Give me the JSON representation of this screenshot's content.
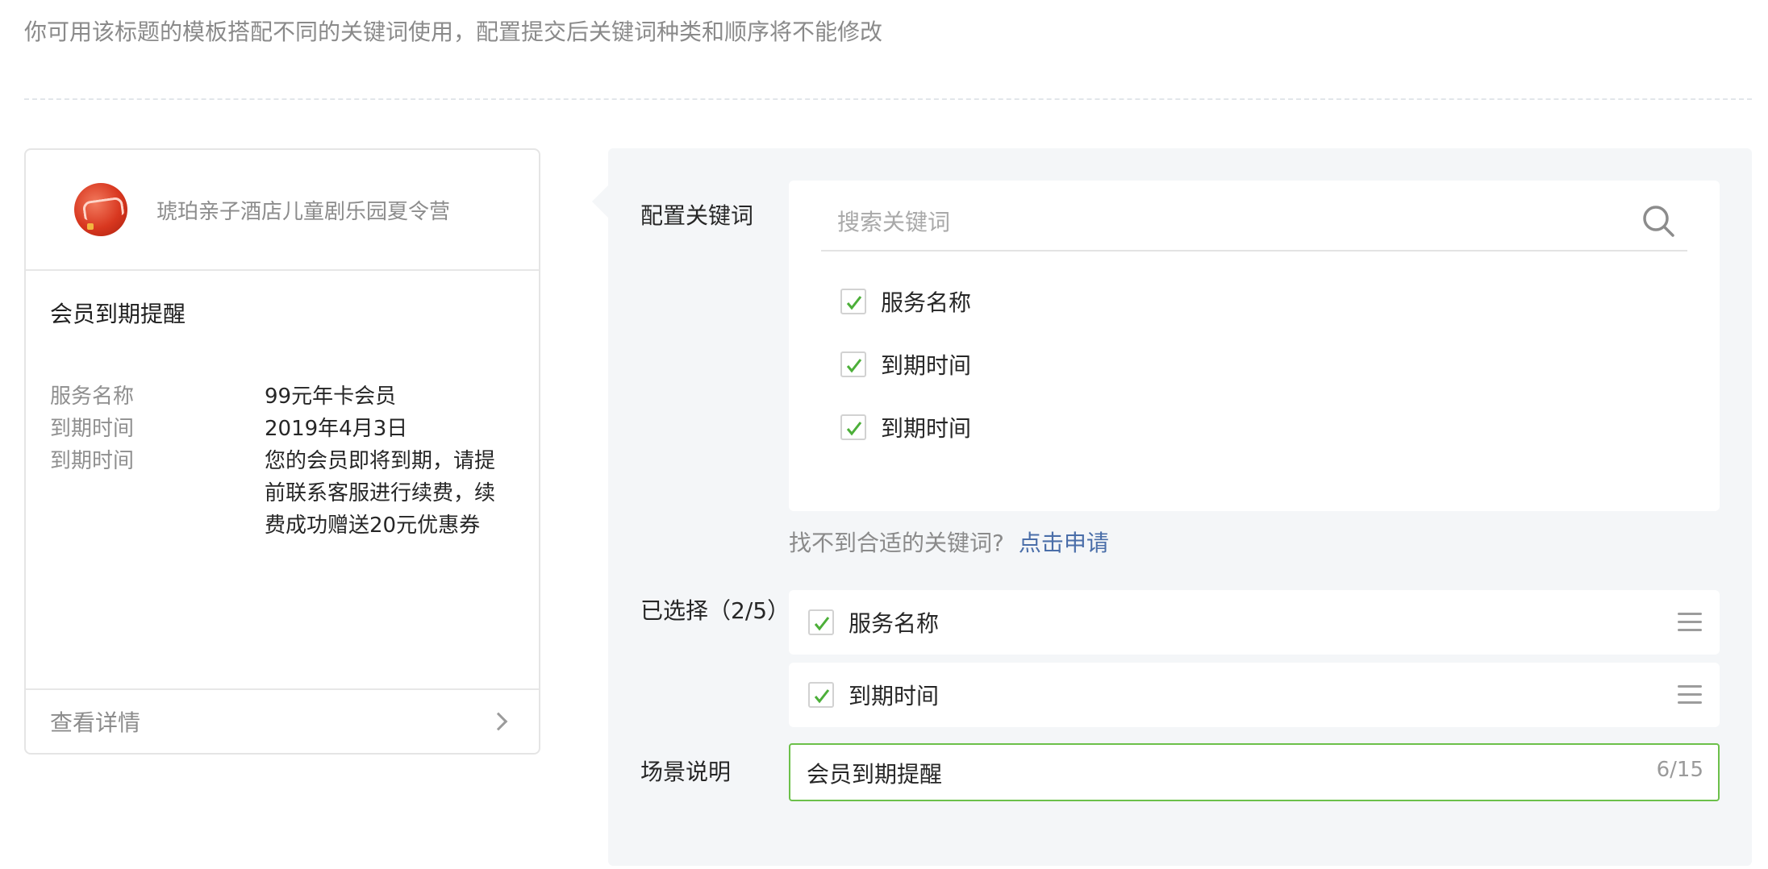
{
  "hint": "你可用该标题的模板搭配不同的关键词使用，配置提交后关键词种类和顺序将不能修改",
  "preview": {
    "account_name": "琥珀亲子酒店儿童剧乐园夏令营",
    "template_title": "会员到期提醒",
    "fields": [
      {
        "key": "服务名称",
        "value": "99元年卡会员"
      },
      {
        "key": "到期时间",
        "value": "2019年4月3日"
      },
      {
        "key": "到期时间",
        "value": "您的会员即将到期，请提前联系客服进行续费，续费成功赠送20元优惠券"
      }
    ],
    "detail_label": "查看详情"
  },
  "config": {
    "keywords_label": "配置关键词",
    "search_placeholder": "搜索关键词",
    "keyword_options": [
      {
        "label": "服务名称",
        "checked": true
      },
      {
        "label": "到期时间",
        "checked": true
      },
      {
        "label": "到期时间",
        "checked": true
      }
    ],
    "not_found_text": "找不到合适的关键词?",
    "apply_link": "点击申请",
    "selected_label": "已选择（2/5）",
    "selected_items": [
      {
        "label": "服务名称",
        "checked": true
      },
      {
        "label": "到期时间",
        "checked": true
      }
    ],
    "scene_label": "场景说明",
    "scene_value": "会员到期提醒",
    "scene_counter": "6/15"
  },
  "colors": {
    "accent_green": "#6cc04a",
    "link_blue": "#4a6ea9",
    "panel_bg": "#f4f6f8"
  }
}
